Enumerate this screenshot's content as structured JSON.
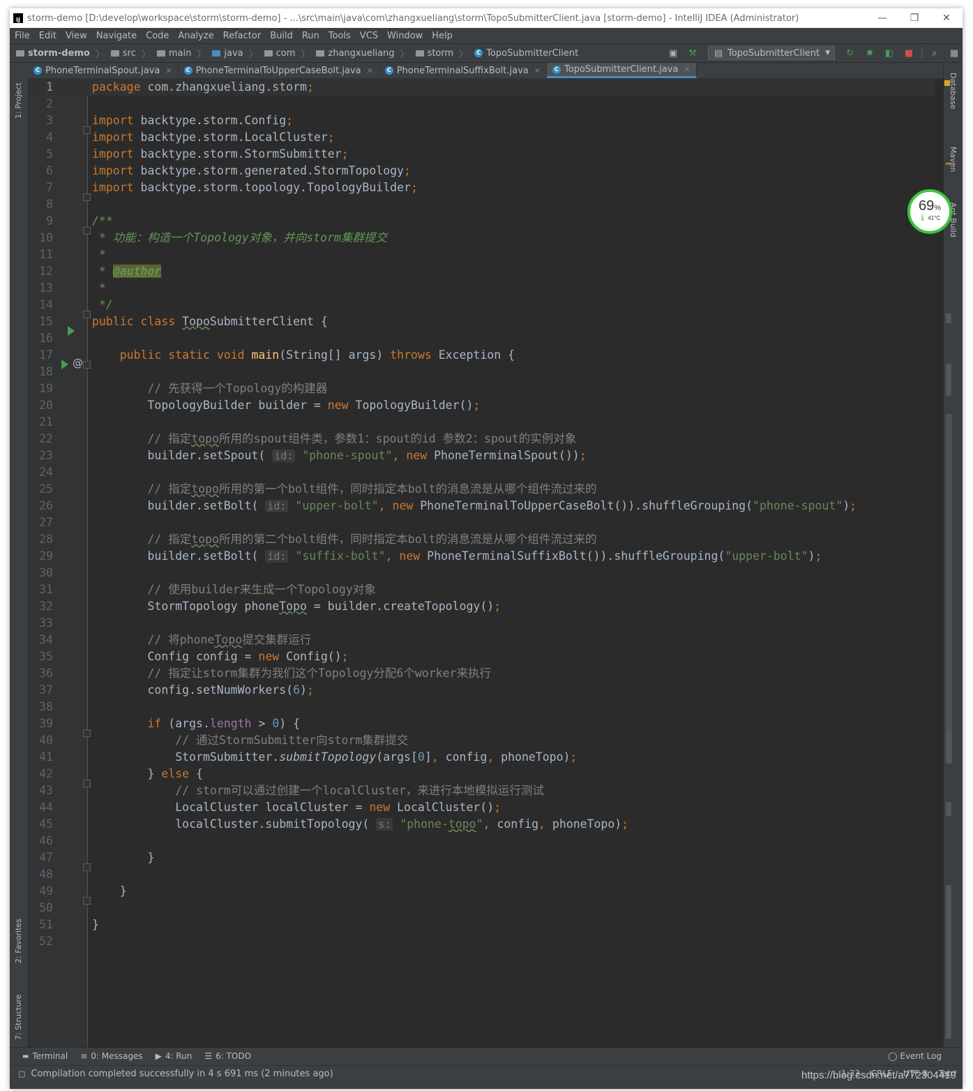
{
  "window": {
    "title": "storm-demo [D:\\develop\\workspace\\storm\\storm-demo] - ...\\src\\main\\java\\com\\zhangxueliang\\storm\\TopoSubmitterClient.java [storm-demo] - IntelliJ IDEA (Administrator)",
    "controls": [
      "—",
      "❐",
      "✕"
    ]
  },
  "menu": [
    "File",
    "Edit",
    "View",
    "Navigate",
    "Code",
    "Analyze",
    "Refactor",
    "Build",
    "Run",
    "Tools",
    "VCS",
    "Window",
    "Help"
  ],
  "breadcrumb": [
    "storm-demo",
    "src",
    "main",
    "java",
    "com",
    "zhangxueliang",
    "storm",
    "TopoSubmitterClient"
  ],
  "toolbar": {
    "run_config": "TopoSubmitterClient"
  },
  "tabs": [
    {
      "label": "PhoneTerminalSpout.java",
      "active": false
    },
    {
      "label": "PhoneTerminalToUpperCaseBolt.java",
      "active": false
    },
    {
      "label": "PhoneTerminalSuffixBolt.java",
      "active": false
    },
    {
      "label": "TopoSubmitterClient.java",
      "active": true
    }
  ],
  "left_strip": [
    "1: Project",
    "2: Favorites",
    "7: Structure"
  ],
  "right_strip": [
    "Database",
    "Maven",
    "Ant Build"
  ],
  "editor": {
    "line_count": 52,
    "current_line": 1
  },
  "gauge": {
    "percent": "69",
    "unit": "%",
    "temperature": "41°C"
  },
  "bottom_tools": [
    {
      "label": "Terminal"
    },
    {
      "label": "0: Messages"
    },
    {
      "label": "4: Run"
    },
    {
      "label": "6: TODO"
    }
  ],
  "event_log": "Event Log",
  "status": {
    "message": "Compilation completed successfully in 4 s 691 ms (2 minutes ago)",
    "position": "1:33",
    "line_sep": "CRLF",
    "encoding": "UTF-8",
    "indent": "Tab*",
    "watermark": "https://blog.csdn.net/a772304419"
  },
  "colors": {
    "keyword": "#cc7832",
    "string": "#6a8759",
    "number": "#6897bb",
    "comment": "#808080",
    "doc": "#629755",
    "editor_bg": "#2b2b2b",
    "gutter_bg": "#313335",
    "gauge_green": "#3ec43e"
  }
}
